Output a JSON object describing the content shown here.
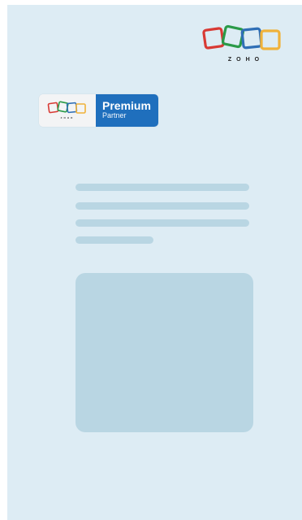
{
  "brand": {
    "logo_word": "ZOHO",
    "colors": {
      "red": "#d83a34",
      "green": "#2a9a48",
      "blue": "#2f6fb6",
      "yellow": "#f0b23a",
      "badge_blue": "#1f6fbd",
      "page_bg": "#ddecf4",
      "placeholder": "#b9d6e3"
    }
  },
  "badge": {
    "title": "Premium",
    "subtitle": "Partner",
    "mini_word": "ZOHO"
  },
  "content": {
    "icon": "zoho-logo-icon"
  }
}
